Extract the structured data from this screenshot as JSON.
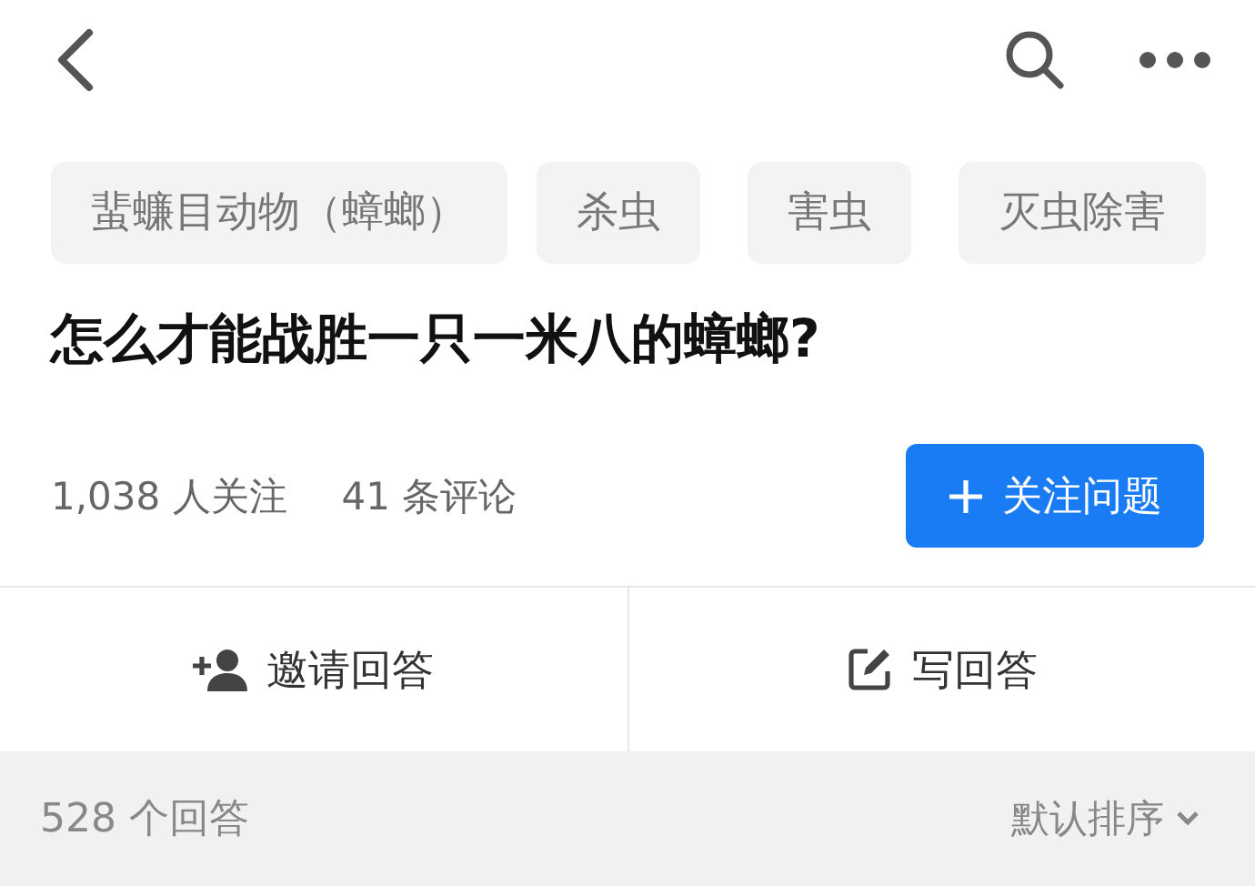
{
  "tags": [
    {
      "label": "蜚蠊目动物（蟑螂）"
    },
    {
      "label": "杀虫"
    },
    {
      "label": "害虫"
    },
    {
      "label": "灭虫除害"
    }
  ],
  "question": {
    "title": "怎么才能战胜一只一米八的蟑螂?"
  },
  "stats": {
    "followers": "1,038 人关注",
    "comments": "41 条评论"
  },
  "follow_button": {
    "label": "关注问题"
  },
  "actions": [
    {
      "kind": "invite",
      "label": "邀请回答"
    },
    {
      "kind": "write",
      "label": "写回答"
    }
  ],
  "answers_bar": {
    "count": "528 个回答",
    "sort": "默认排序"
  }
}
